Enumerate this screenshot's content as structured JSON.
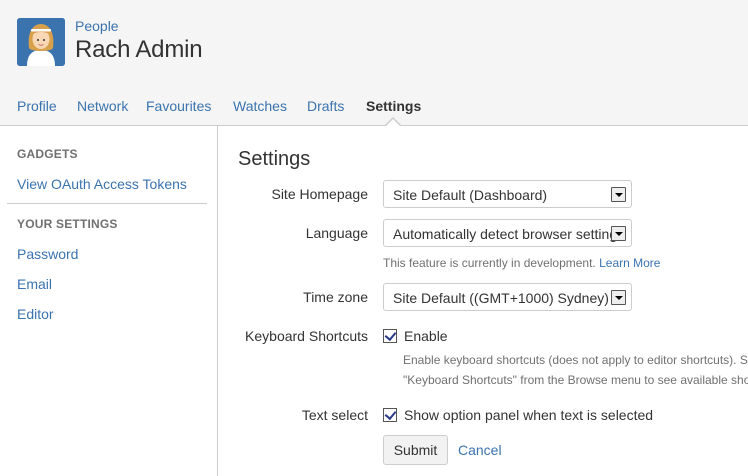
{
  "header": {
    "breadcrumb": "People",
    "title": "Rach Admin"
  },
  "tabs": [
    {
      "label": "Profile"
    },
    {
      "label": "Network"
    },
    {
      "label": "Favourites"
    },
    {
      "label": "Watches"
    },
    {
      "label": "Drafts"
    },
    {
      "label": "Settings",
      "active": true
    }
  ],
  "sidebar": {
    "gadgets_heading": "GADGETS",
    "oauth_link": "View OAuth Access Tokens",
    "settings_heading": "YOUR SETTINGS",
    "links": [
      "Password",
      "Email",
      "Editor"
    ]
  },
  "main": {
    "title": "Settings",
    "site_homepage": {
      "label": "Site Homepage",
      "value": "Site Default (Dashboard)"
    },
    "language": {
      "label": "Language",
      "value": "Automatically detect browser setting",
      "hint": "This feature is currently in development.",
      "hint_link": "Learn More"
    },
    "time_zone": {
      "label": "Time zone",
      "value": "Site Default ((GMT+1000) Sydney)"
    },
    "keyboard_shortcuts": {
      "label": "Keyboard Shortcuts",
      "checkbox_label": "Enable",
      "checked": true,
      "desc_line1": "Enable keyboard shortcuts (does not apply to editor shortcuts). See",
      "desc_line2": "\"Keyboard Shortcuts\" from the Browse menu to see available shortcuts."
    },
    "text_select": {
      "label": "Text select",
      "checkbox_label": "Show option panel when text is selected",
      "checked": true
    },
    "submit_label": "Submit",
    "cancel_label": "Cancel"
  },
  "colors": {
    "link": "#3b73af",
    "text": "#333333",
    "muted": "#707070",
    "header_bg": "#f5f5f5",
    "border": "#cccccc"
  }
}
